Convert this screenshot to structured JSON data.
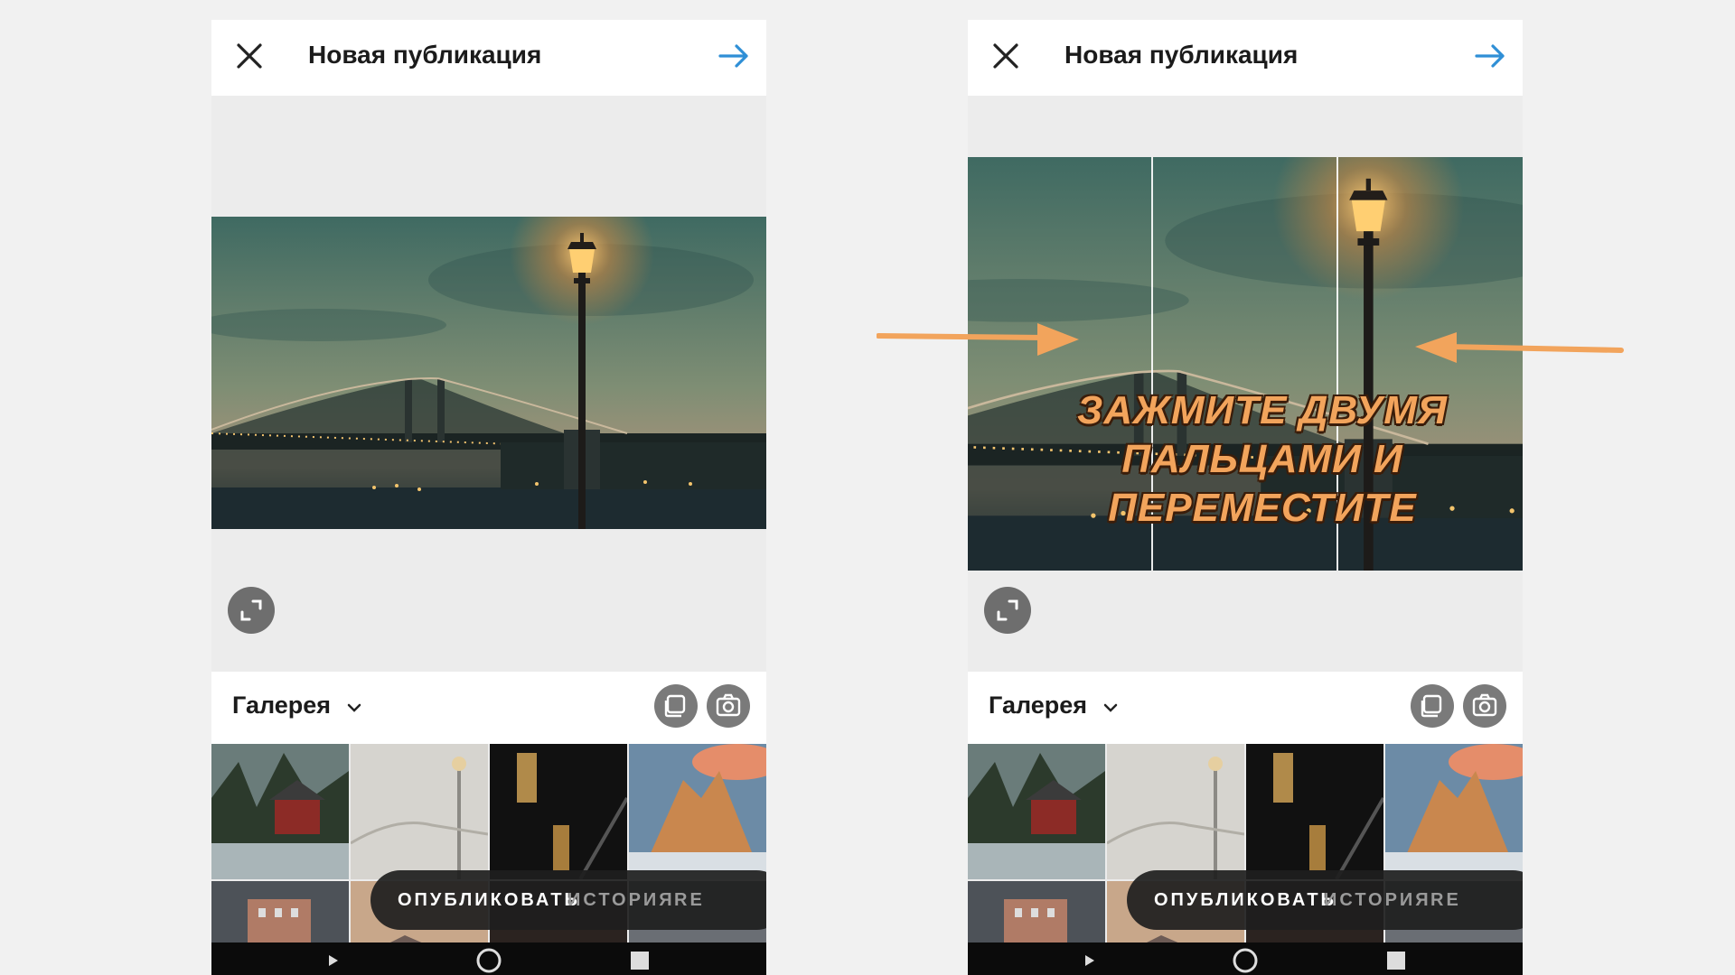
{
  "screens": [
    {
      "header": {
        "title": "Новая публикация"
      },
      "gallery": {
        "label": "Галерея"
      },
      "modes": [
        "ОПУБЛИКОВАТЬ",
        "ИСТОРИЯ",
        "RE"
      ]
    },
    {
      "header": {
        "title": "Новая публикация"
      },
      "gallery": {
        "label": "Галерея"
      },
      "modes": [
        "ОПУБЛИКОВАТЬ",
        "ИСТОРИЯ",
        "RE"
      ]
    }
  ],
  "annotation": {
    "line1": "ЗАЖМИТЕ ДВУМЯ",
    "line2": "ПАЛЬЦАМИ И ПЕРЕМЕСТИТЕ",
    "color": "#f2a45c"
  },
  "icons": {
    "close": "close-icon",
    "next": "arrow-right-icon",
    "expand": "expand-icon",
    "chevron": "chevron-down-icon",
    "multi_select": "multi-select-icon",
    "camera": "camera-icon"
  },
  "colors": {
    "accent": "#2f8fd6",
    "mode_active": "#ffffff",
    "mode_inactive": "#9a9a9a"
  }
}
